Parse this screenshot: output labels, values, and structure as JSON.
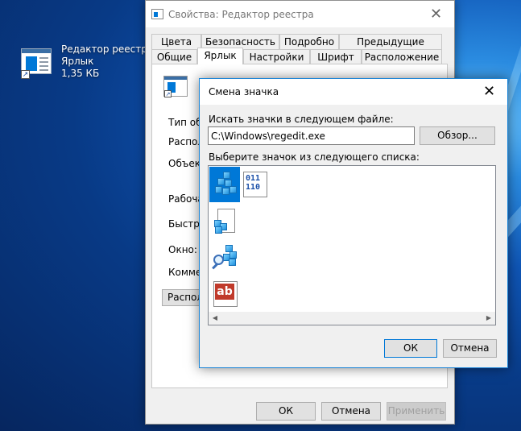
{
  "desktop": {
    "shortcut": {
      "name": "Редактор реестра",
      "type": "Ярлык",
      "size": "1,35 КБ",
      "icon": "regedit-shortcut-icon"
    }
  },
  "properties_window": {
    "title": "Свойства: Редактор реестра",
    "tabs_row1": [
      "Цвета",
      "Безопасность",
      "Подробно",
      "Предыдущие версии"
    ],
    "tabs_row2": [
      "Общие",
      "Ярлык",
      "Настройки",
      "Шрифт",
      "Расположение"
    ],
    "active_tab": "Ярлык",
    "fields": {
      "target_type": "Тип объе",
      "location": "Располож",
      "target": "Объект:",
      "start_in": "Рабочая п",
      "shortcut_key": "Быстрый",
      "run": "Окно:",
      "comment": "Коммент"
    },
    "open_location_button": "Располо",
    "ok": "ОК",
    "cancel": "Отмена",
    "apply": "Применить"
  },
  "change_icon_dialog": {
    "title": "Смена значка",
    "search_label": "Искать значки в следующем файле:",
    "file_path": "C:\\Windows\\regedit.exe",
    "browse": "Обзор...",
    "list_label": "Выберите значок из следующего списка:",
    "icons": [
      "regedit-cubes-icon",
      "binary-data-icon",
      "registry-file-icon",
      "registry-search-icon",
      "string-value-icon"
    ],
    "selected_index": 0,
    "string_icon_text": "ab",
    "binary_icon_text": [
      "011",
      "110"
    ],
    "ok": "ОК",
    "cancel": "Отмена"
  }
}
